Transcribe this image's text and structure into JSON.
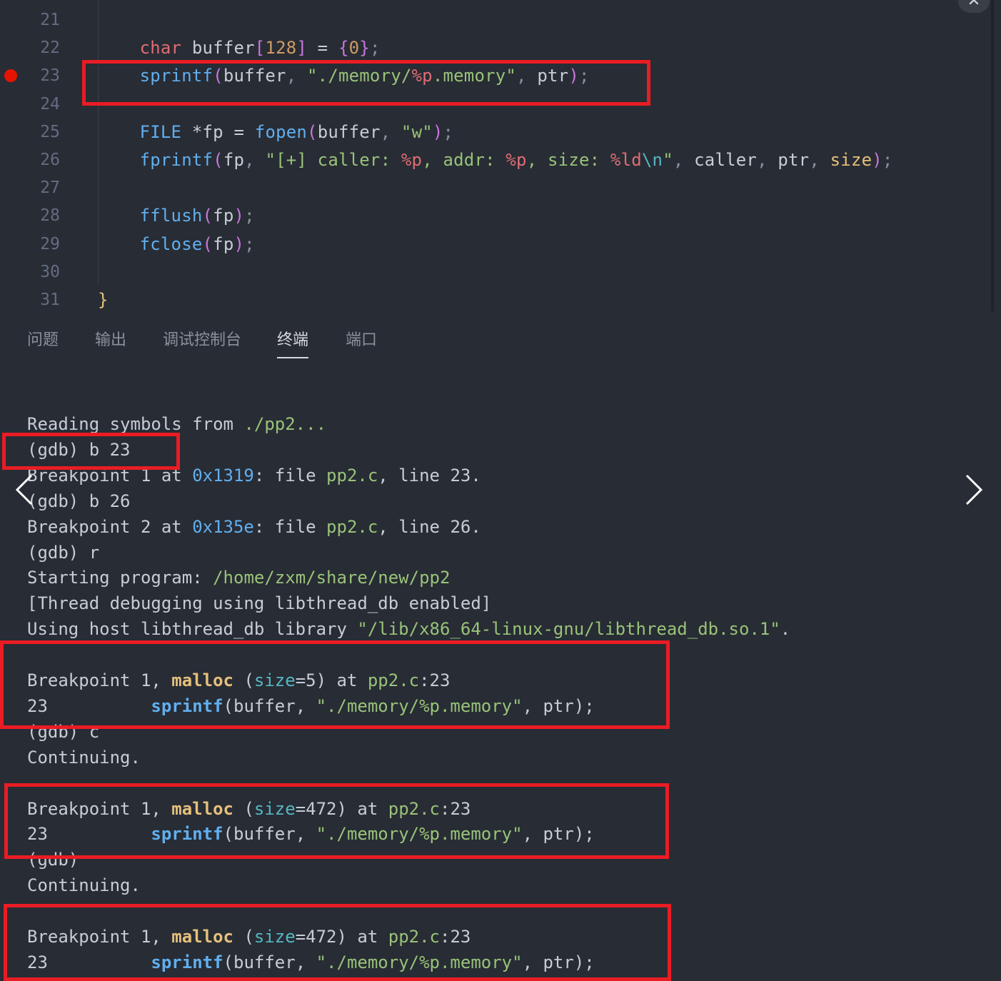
{
  "editor": {
    "lines": [
      {
        "num": "21",
        "tokens": []
      },
      {
        "num": "22",
        "tokens": [
          {
            "c": "    ",
            "k": "plain"
          },
          {
            "c": "char",
            "k": "kw"
          },
          {
            "c": " buffer",
            "k": "plain"
          },
          {
            "c": "[",
            "k": "br1"
          },
          {
            "c": "128",
            "k": "num"
          },
          {
            "c": "]",
            "k": "br1"
          },
          {
            "c": " = ",
            "k": "plain"
          },
          {
            "c": "{",
            "k": "br1"
          },
          {
            "c": "0",
            "k": "num"
          },
          {
            "c": "}",
            "k": "br1"
          },
          {
            "c": ";",
            "k": "punct"
          }
        ]
      },
      {
        "num": "23",
        "breakpoint": true,
        "tokens": [
          {
            "c": "    ",
            "k": "plain"
          },
          {
            "c": "sprintf",
            "k": "fn"
          },
          {
            "c": "(",
            "k": "br1"
          },
          {
            "c": "buffer",
            "k": "plain"
          },
          {
            "c": ", ",
            "k": "punct"
          },
          {
            "c": "\"./memory/",
            "k": "str"
          },
          {
            "c": "%p",
            "k": "fmt"
          },
          {
            "c": ".memory\"",
            "k": "str"
          },
          {
            "c": ", ",
            "k": "punct"
          },
          {
            "c": "ptr",
            "k": "plain"
          },
          {
            "c": ")",
            "k": "br1"
          },
          {
            "c": ";",
            "k": "punct"
          }
        ]
      },
      {
        "num": "24",
        "tokens": []
      },
      {
        "num": "25",
        "tokens": [
          {
            "c": "    ",
            "k": "plain"
          },
          {
            "c": "FILE",
            "k": "fn"
          },
          {
            "c": " *",
            "k": "plain"
          },
          {
            "c": "fp",
            "k": "plain"
          },
          {
            "c": " = ",
            "k": "plain"
          },
          {
            "c": "fopen",
            "k": "fn"
          },
          {
            "c": "(",
            "k": "br1"
          },
          {
            "c": "buffer",
            "k": "plain"
          },
          {
            "c": ", ",
            "k": "punct"
          },
          {
            "c": "\"w\"",
            "k": "str"
          },
          {
            "c": ")",
            "k": "br1"
          },
          {
            "c": ";",
            "k": "punct"
          }
        ]
      },
      {
        "num": "26",
        "tokens": [
          {
            "c": "    ",
            "k": "plain"
          },
          {
            "c": "fprintf",
            "k": "fn"
          },
          {
            "c": "(",
            "k": "br1"
          },
          {
            "c": "fp",
            "k": "plain"
          },
          {
            "c": ", ",
            "k": "punct"
          },
          {
            "c": "\"[+] caller: ",
            "k": "str"
          },
          {
            "c": "%p",
            "k": "fmt"
          },
          {
            "c": ", addr: ",
            "k": "str"
          },
          {
            "c": "%p",
            "k": "fmt"
          },
          {
            "c": ", size: ",
            "k": "str"
          },
          {
            "c": "%ld",
            "k": "fmt"
          },
          {
            "c": "\\n",
            "k": "esc"
          },
          {
            "c": "\"",
            "k": "str"
          },
          {
            "c": ", ",
            "k": "punct"
          },
          {
            "c": "caller",
            "k": "plain"
          },
          {
            "c": ", ",
            "k": "punct"
          },
          {
            "c": "ptr",
            "k": "plain"
          },
          {
            "c": ", ",
            "k": "punct"
          },
          {
            "c": "size",
            "k": "param"
          },
          {
            "c": ")",
            "k": "br1"
          },
          {
            "c": ";",
            "k": "punct"
          }
        ]
      },
      {
        "num": "27",
        "tokens": []
      },
      {
        "num": "28",
        "tokens": [
          {
            "c": "    ",
            "k": "plain"
          },
          {
            "c": "fflush",
            "k": "fn"
          },
          {
            "c": "(",
            "k": "br1"
          },
          {
            "c": "fp",
            "k": "plain"
          },
          {
            "c": ")",
            "k": "br1"
          },
          {
            "c": ";",
            "k": "punct"
          }
        ]
      },
      {
        "num": "29",
        "tokens": [
          {
            "c": "    ",
            "k": "plain"
          },
          {
            "c": "fclose",
            "k": "fn"
          },
          {
            "c": "(",
            "k": "br1"
          },
          {
            "c": "fp",
            "k": "plain"
          },
          {
            "c": ")",
            "k": "br1"
          },
          {
            "c": ";",
            "k": "punct"
          }
        ]
      },
      {
        "num": "30",
        "tokens": []
      },
      {
        "num": "31",
        "tokens": [
          {
            "c": "}",
            "k": "br2"
          }
        ]
      }
    ]
  },
  "panel": {
    "tabs": [
      {
        "label": "问题",
        "active": false
      },
      {
        "label": "输出",
        "active": false
      },
      {
        "label": "调试控制台",
        "active": false
      },
      {
        "label": "终端",
        "active": true
      },
      {
        "label": "端口",
        "active": false
      }
    ]
  },
  "terminal": {
    "lines": [
      [
        {
          "c": "Reading symbols from ",
          "k": "plain"
        },
        {
          "c": "./pp2...",
          "k": "path"
        }
      ],
      [
        {
          "c": "(gdb) b 23",
          "k": "plain"
        }
      ],
      [
        {
          "c": "Breakpoint 1 at ",
          "k": "plain"
        },
        {
          "c": "0x1319",
          "k": "addr"
        },
        {
          "c": ": file ",
          "k": "plain"
        },
        {
          "c": "pp2.c",
          "k": "file"
        },
        {
          "c": ", line 23.",
          "k": "plain"
        }
      ],
      [
        {
          "c": "(gdb) b 26",
          "k": "plain"
        }
      ],
      [
        {
          "c": "Breakpoint 2 at ",
          "k": "plain"
        },
        {
          "c": "0x135e",
          "k": "addr"
        },
        {
          "c": ": file ",
          "k": "plain"
        },
        {
          "c": "pp2.c",
          "k": "file"
        },
        {
          "c": ", line 26.",
          "k": "plain"
        }
      ],
      [
        {
          "c": "(gdb) r",
          "k": "plain"
        }
      ],
      [
        {
          "c": "Starting program: ",
          "k": "plain"
        },
        {
          "c": "/home/zxm/share/new/pp2",
          "k": "path"
        }
      ],
      [
        {
          "c": "[Thread debugging using libthread_db enabled]",
          "k": "plain"
        }
      ],
      [
        {
          "c": "Using host libthread_db library ",
          "k": "plain"
        },
        {
          "c": "\"/lib/x86_64-linux-gnu/libthread_db.so.1\"",
          "k": "path"
        },
        {
          "c": ".",
          "k": "plain"
        }
      ],
      [],
      [
        {
          "c": "Breakpoint 1, ",
          "k": "plain"
        },
        {
          "c": "malloc",
          "k": "func"
        },
        {
          "c": " (",
          "k": "plain"
        },
        {
          "c": "size",
          "k": "arg"
        },
        {
          "c": "=5) at ",
          "k": "plain"
        },
        {
          "c": "pp2.c",
          "k": "file"
        },
        {
          "c": ":23",
          "k": "plain"
        }
      ],
      [
        {
          "c": "23          ",
          "k": "plain"
        },
        {
          "c": "sprintf",
          "k": "fnb"
        },
        {
          "c": "(buffer, ",
          "k": "plain"
        },
        {
          "c": "\"./memory/%p.memory\"",
          "k": "str"
        },
        {
          "c": ", ptr);",
          "k": "plain"
        }
      ],
      [
        {
          "c": "(gdb) c",
          "k": "plain"
        }
      ],
      [
        {
          "c": "Continuing.",
          "k": "plain"
        }
      ],
      [],
      [
        {
          "c": "Breakpoint 1, ",
          "k": "plain"
        },
        {
          "c": "malloc",
          "k": "func"
        },
        {
          "c": " (",
          "k": "plain"
        },
        {
          "c": "size",
          "k": "arg"
        },
        {
          "c": "=472) at ",
          "k": "plain"
        },
        {
          "c": "pp2.c",
          "k": "file"
        },
        {
          "c": ":23",
          "k": "plain"
        }
      ],
      [
        {
          "c": "23          ",
          "k": "plain"
        },
        {
          "c": "sprintf",
          "k": "fnb"
        },
        {
          "c": "(buffer, ",
          "k": "plain"
        },
        {
          "c": "\"./memory/%p.memory\"",
          "k": "str"
        },
        {
          "c": ", ptr);",
          "k": "plain"
        }
      ],
      [
        {
          "c": "(gdb)",
          "k": "plain"
        }
      ],
      [
        {
          "c": "Continuing.",
          "k": "plain"
        }
      ],
      [],
      [
        {
          "c": "Breakpoint 1, ",
          "k": "plain"
        },
        {
          "c": "malloc",
          "k": "func"
        },
        {
          "c": " (",
          "k": "plain"
        },
        {
          "c": "size",
          "k": "arg"
        },
        {
          "c": "=472) at ",
          "k": "plain"
        },
        {
          "c": "pp2.c",
          "k": "file"
        },
        {
          "c": ":23",
          "k": "plain"
        }
      ],
      [
        {
          "c": "23          ",
          "k": "plain"
        },
        {
          "c": "sprintf",
          "k": "fnb"
        },
        {
          "c": "(buffer, ",
          "k": "plain"
        },
        {
          "c": "\"./memory/%p.memory\"",
          "k": "str"
        },
        {
          "c": ", ptr);",
          "k": "plain"
        }
      ]
    ]
  },
  "icons": {
    "close": "close-icon",
    "prev": "chevron-left-icon",
    "next": "chevron-right-icon",
    "breakpoint": "breakpoint-icon"
  },
  "colors": {
    "background": "#282c34",
    "annotation": "#ea1c24",
    "breakpoint": "#e51400"
  }
}
